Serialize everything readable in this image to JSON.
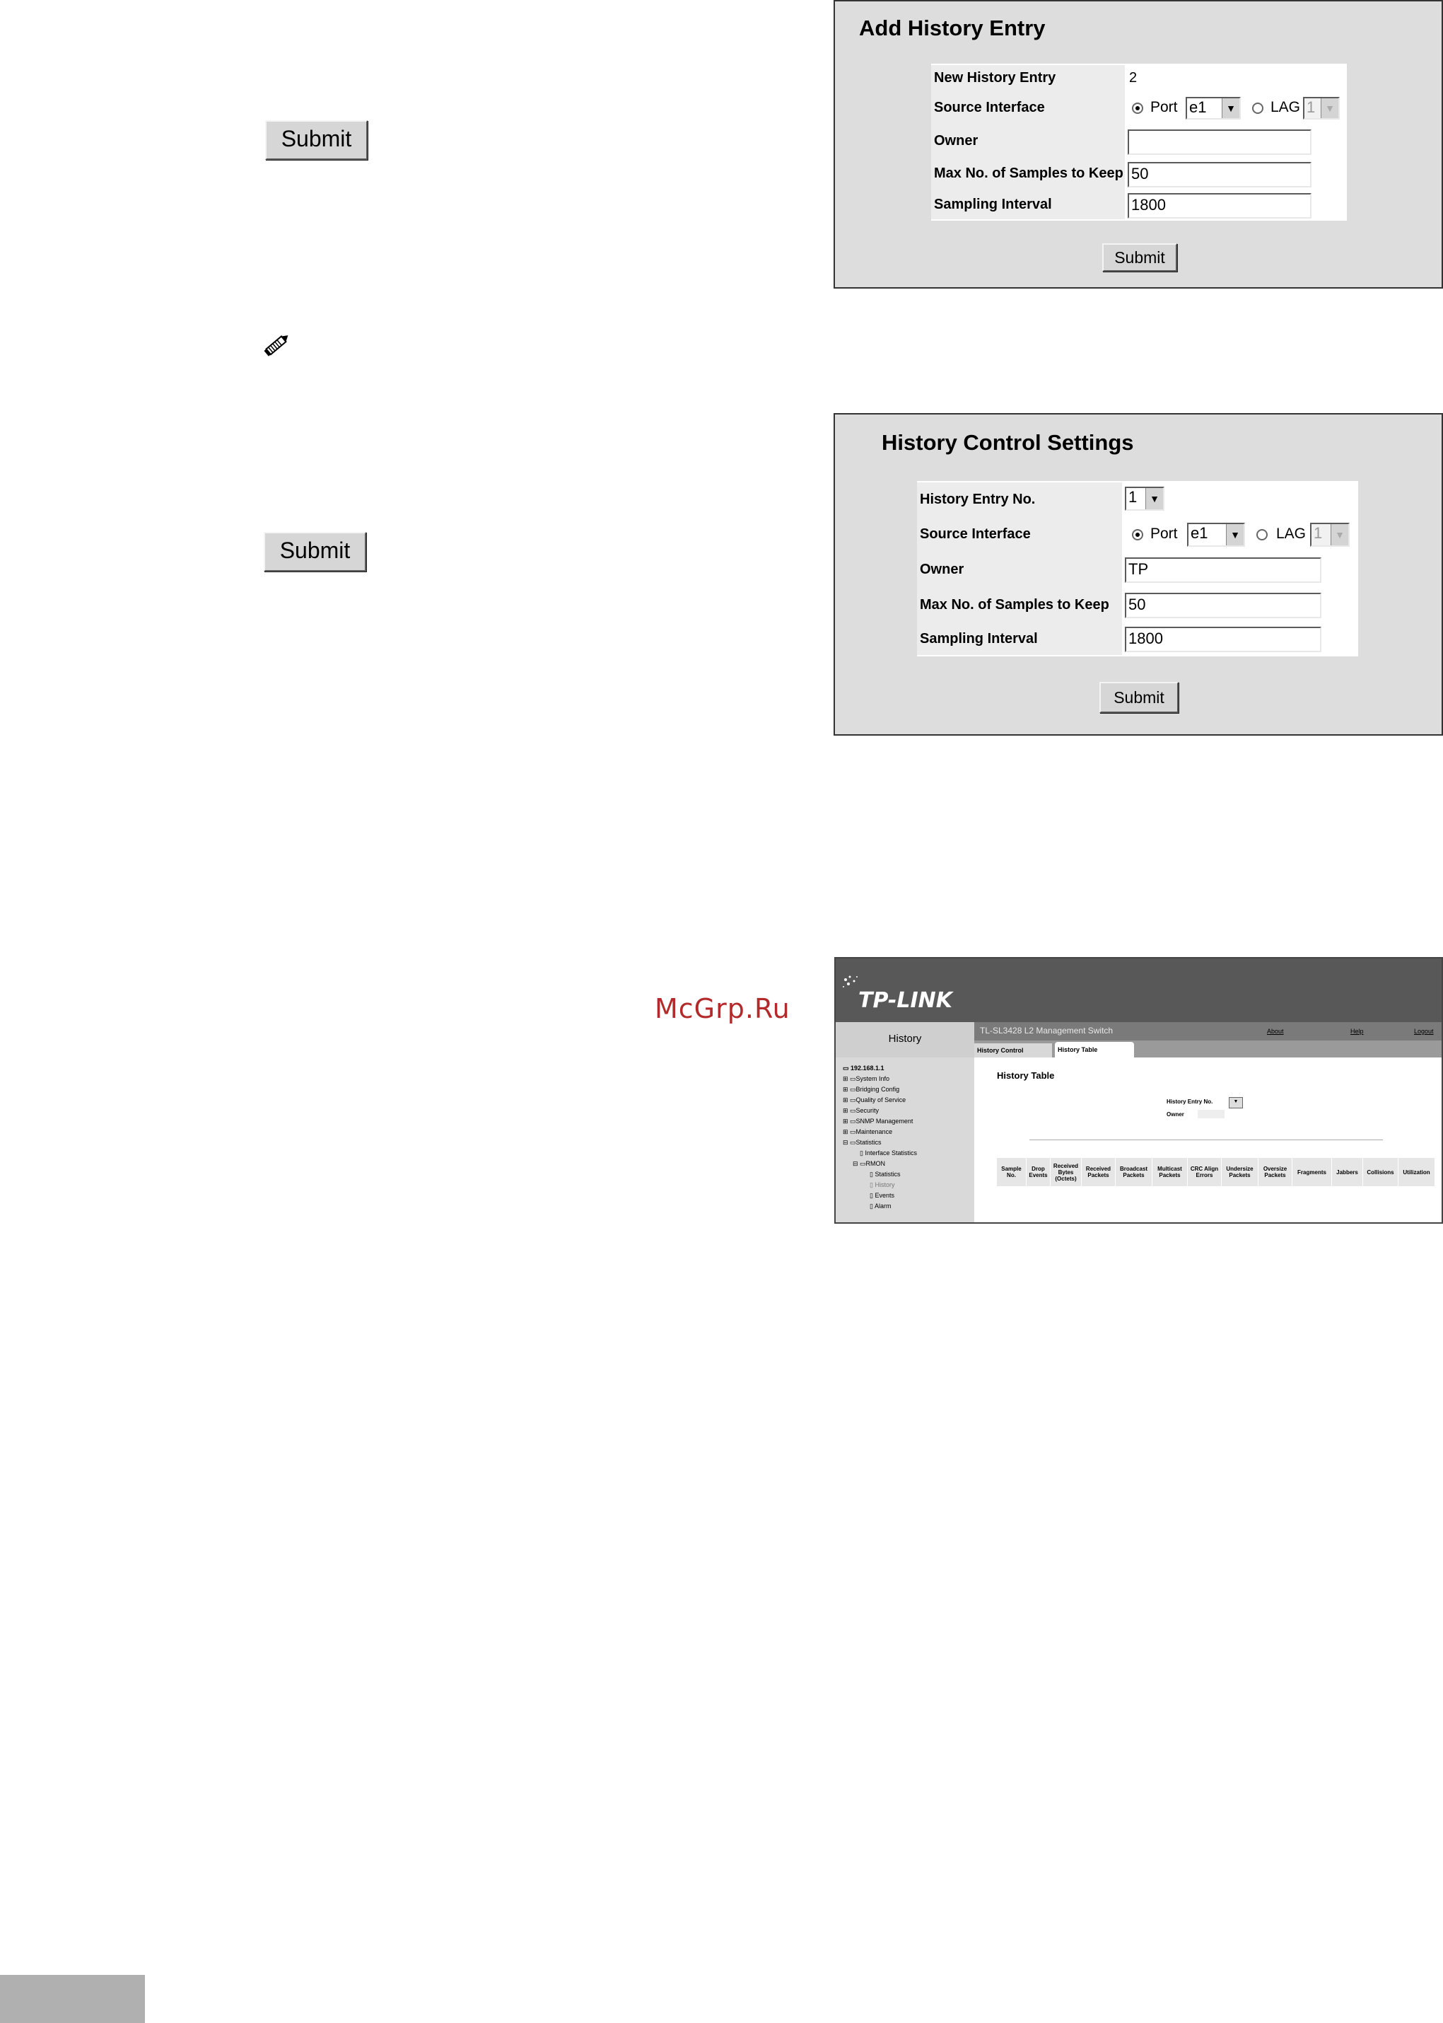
{
  "left_buttons": [
    {
      "label": "Submit"
    },
    {
      "label": "Submit"
    }
  ],
  "add_history_entry": {
    "title": "Add History Entry",
    "fields": {
      "new_entry_label": "New History Entry",
      "new_entry_value": "2",
      "source_label": "Source Interface",
      "port_label": "Port",
      "port_value": "e1",
      "lag_label": "LAG",
      "lag_value": "1",
      "owner_label": "Owner",
      "owner_value": "",
      "max_samples_label": "Max No. of Samples to Keep",
      "max_samples_value": "50",
      "interval_label": "Sampling Interval",
      "interval_value": "1800"
    },
    "submit_label": "Submit"
  },
  "history_control_settings": {
    "title": "History Control Settings",
    "fields": {
      "entry_no_label": "History Entry No.",
      "entry_no_value": "1",
      "source_label": "Source Interface",
      "port_label": "Port",
      "port_value": "e1",
      "lag_label": "LAG",
      "lag_value": "1",
      "owner_label": "Owner",
      "owner_value": "TP",
      "max_samples_label": "Max No. of Samples to Keep",
      "max_samples_value": "50",
      "interval_label": "Sampling Interval",
      "interval_value": "1800"
    },
    "submit_label": "Submit"
  },
  "watermark": "McGrp.Ru",
  "tplink": {
    "logo": "TP-LINK",
    "section": "History",
    "device_title": "TL-SL3428 L2 Management Switch",
    "links": {
      "about": "About",
      "help": "Help",
      "logout": "Logout"
    },
    "tabs": [
      "History Control",
      "History Table"
    ],
    "page_title": "History Table",
    "entry_no_label": "History Entry No.",
    "owner_label": "Owner",
    "tree": {
      "root": "192.168.1.1",
      "items": [
        "System Info",
        "Bridging Config",
        "Quality of Service",
        "Security",
        "SNMP Management",
        "Maintenance",
        "Statistics"
      ],
      "statistics_children": [
        "Interface Statistics",
        "RMON"
      ],
      "rmon_children": [
        "Statistics",
        "History",
        "Events",
        "Alarm"
      ]
    },
    "columns": [
      "Sample No.",
      "Drop Events",
      "Received Bytes (Octets)",
      "Received Packets",
      "Broadcast Packets",
      "Multicast Packets",
      "CRC Align Errors",
      "Undersize Packets",
      "Oversize Packets",
      "Fragments",
      "Jabbers",
      "Collisions",
      "Utilization"
    ]
  }
}
